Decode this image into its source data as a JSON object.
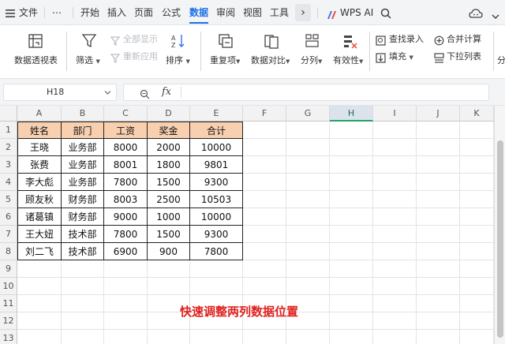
{
  "menu": {
    "file": "文件",
    "more": "⋯",
    "tabs": [
      "开始",
      "插入",
      "页面",
      "公式",
      "数据",
      "审阅",
      "视图",
      "工具"
    ],
    "active_tab": "数据",
    "expand": "›",
    "wps_ai": "WPS AI",
    "accent_color": "#1a6fe6"
  },
  "ribbon": {
    "pivot": "数据透视表",
    "filter": "筛选",
    "show_all": "全部显示",
    "reapply": "重新应用",
    "sort": "排序",
    "duplicates": "重复项",
    "compare": "数据对比",
    "split": "分列",
    "validity": "有效性",
    "lookup_entry": "查找录入",
    "fill": "填充",
    "merge_calc": "合并计算",
    "dropdown_list": "下拉列表",
    "partial": "分"
  },
  "formula_bar": {
    "cell_ref": "H18",
    "fx": "fx",
    "value": ""
  },
  "sheet": {
    "columns": [
      "A",
      "B",
      "C",
      "D",
      "E",
      "F",
      "G",
      "H",
      "I",
      "J",
      "K"
    ],
    "selected_column": "H",
    "rows": [
      "1",
      "2",
      "3",
      "4",
      "5",
      "6",
      "7",
      "8",
      "9",
      "10",
      "11",
      "12",
      "13"
    ],
    "table": {
      "headers": [
        "姓名",
        "部门",
        "工资",
        "奖金",
        "合计"
      ],
      "data": [
        [
          "王晓",
          "业务部",
          "8000",
          "2000",
          "10000"
        ],
        [
          "张费",
          "业务部",
          "8001",
          "1800",
          "9801"
        ],
        [
          "李大彪",
          "业务部",
          "7800",
          "1500",
          "9300"
        ],
        [
          "顾友秋",
          "财务部",
          "8003",
          "2500",
          "10503"
        ],
        [
          "诸葛镇",
          "财务部",
          "9000",
          "1000",
          "10000"
        ],
        [
          "王大妞",
          "技术部",
          "7800",
          "1500",
          "9300"
        ],
        [
          "刘二飞",
          "技术部",
          "6900",
          "900",
          "7800"
        ]
      ]
    },
    "header_fill": "#f8d0b0",
    "caption": "快速调整两列数据位置",
    "caption_color": "#e0201c"
  }
}
